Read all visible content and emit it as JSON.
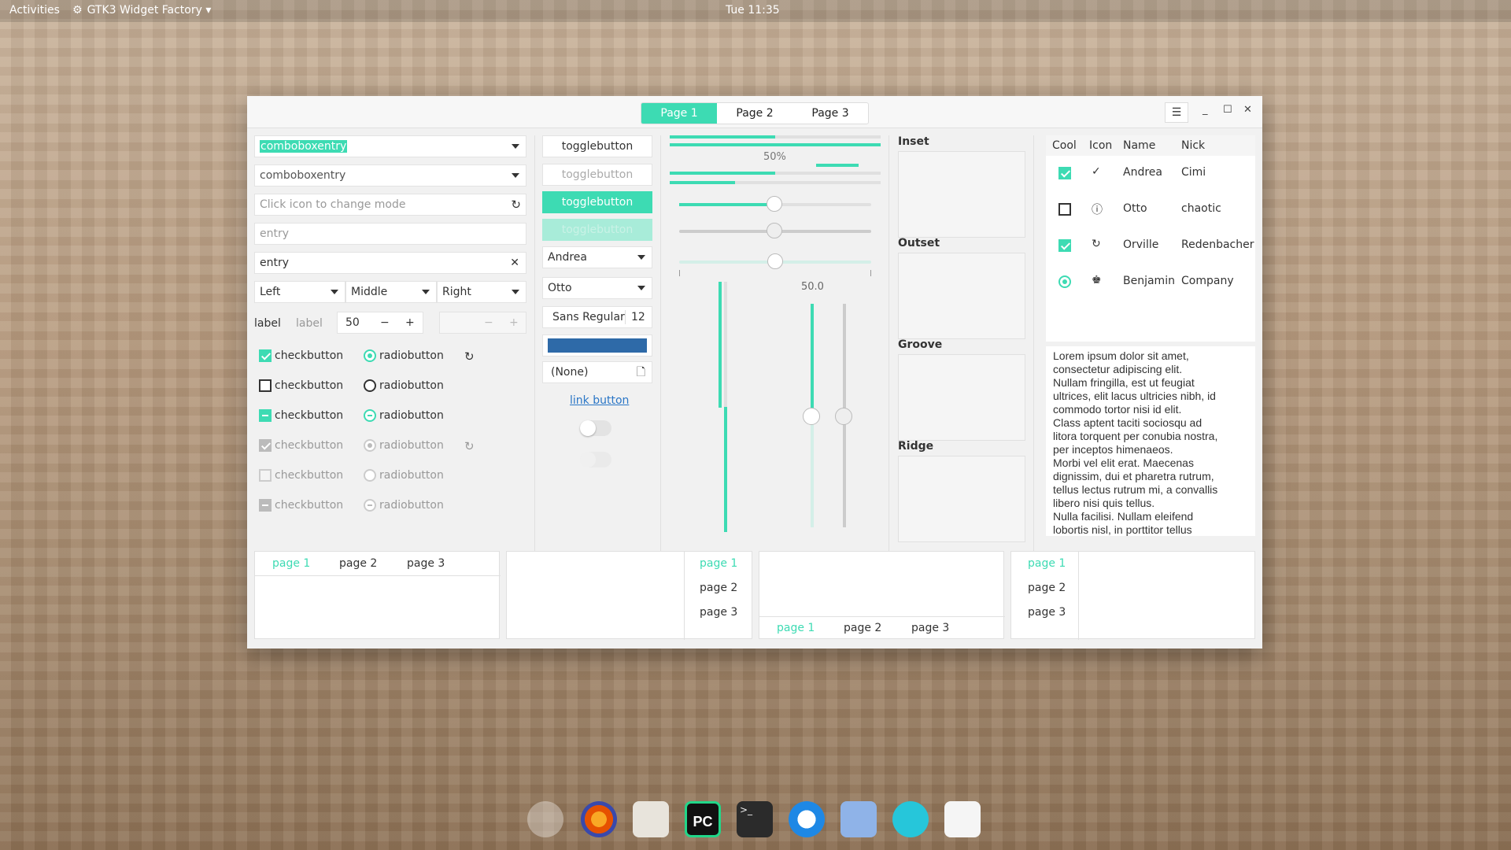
{
  "topbar": {
    "activities": "Activities",
    "app_name": "GTK3 Widget Factory",
    "clock": "Tue 11:35"
  },
  "header": {
    "tabs": [
      "Page 1",
      "Page 2",
      "Page 3"
    ],
    "menu_icon": "hamburger-icon"
  },
  "entries": {
    "combo1": "comboboxentry",
    "combo2": "comboboxentry",
    "mode_placeholder": "Click icon to change mode",
    "entry_placeholder": "entry",
    "entry_value": "entry",
    "align_left": "Left",
    "align_middle": "Middle",
    "align_right": "Right",
    "label1": "label",
    "label2": "label",
    "spin_value": "50"
  },
  "checks": [
    "checkbutton",
    "checkbutton",
    "checkbutton",
    "checkbutton",
    "checkbutton",
    "checkbutton"
  ],
  "radios": [
    "radiobutton",
    "radiobutton",
    "radiobutton",
    "radiobutton",
    "radiobutton",
    "radiobutton"
  ],
  "buttons": {
    "toggle1": "togglebutton",
    "toggle2": "togglebutton",
    "toggle3": "togglebutton",
    "toggle4": "togglebutton",
    "combo_andrea": "Andrea",
    "combo_otto": "Otto",
    "font_name": "Sans Regular",
    "font_size": "12",
    "file_none": "(None)",
    "link": "link button",
    "switch1_on": false,
    "switch2_on": false
  },
  "progress": {
    "label": "50%",
    "scale_value": "50.0",
    "fraction": 0.5
  },
  "frames": {
    "inset": "Inset",
    "outset": "Outset",
    "groove": "Groove",
    "ridge": "Ridge"
  },
  "tree": {
    "headers": [
      "Cool",
      "Icon",
      "Name",
      "Nick"
    ],
    "rows": [
      {
        "cool": true,
        "radio": false,
        "icon": "check-circle-icon",
        "name": "Andrea",
        "nick": "Cimi"
      },
      {
        "cool": false,
        "radio": false,
        "icon": "warning-circle-icon",
        "name": "Otto",
        "nick": "chaotic"
      },
      {
        "cool": true,
        "radio": false,
        "icon": "spinner-icon",
        "name": "Orville",
        "nick": "Redenbacher"
      },
      {
        "cool": true,
        "radio": true,
        "icon": "cap-icon",
        "name": "Benjamin",
        "nick": "Company"
      }
    ]
  },
  "textview": "Lorem ipsum dolor sit amet,\nconsectetur adipiscing elit.\nNullam fringilla, est ut feugiat\nultrices, elit lacus ultricies nibh, id\ncommodo tortor nisi id elit.\nClass aptent taciti sociosqu ad\nlitora torquent per conubia nostra,\nper inceptos himenaeos.\nMorbi vel elit erat. Maecenas\ndignissim, dui et pharetra rutrum,\ntellus lectus rutrum mi, a convallis\nlibero nisi quis tellus.\nNulla facilisi. Nullam eleifend\nlobortis nisl, in porttitor tellus",
  "notebooks": {
    "nb1": [
      "page 1",
      "page 2",
      "page 3"
    ],
    "nb2": [
      "page 1",
      "page 2",
      "page 3"
    ],
    "nb3": [
      "page 1",
      "page 2",
      "page 3"
    ],
    "nb4": [
      "page 1",
      "page 2",
      "page 3"
    ]
  },
  "dock": [
    "help-icon",
    "firefox-icon",
    "files-icon",
    "pycharm-icon",
    "terminal-icon",
    "update-icon",
    "mail-icon",
    "audio-icon",
    "settings-icon"
  ],
  "colors": {
    "accent": "#3ddbb3",
    "color_button": "#2e6aa8"
  }
}
